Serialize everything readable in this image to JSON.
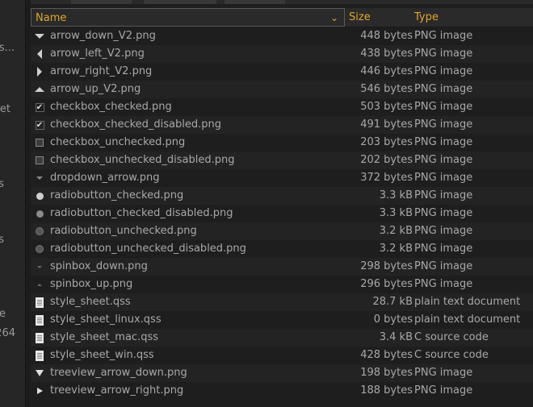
{
  "sidebar": {
    "fragments": [
      "s...",
      "et",
      "s",
      "s",
      "e",
      "264"
    ]
  },
  "header": {
    "name_label": "Name",
    "size_label": "Size",
    "type_label": "Type"
  },
  "files": [
    {
      "name": "arrow_down_V2.png",
      "size": "448 bytes",
      "type": "PNG image",
      "icon": "tri-down"
    },
    {
      "name": "arrow_left_V2.png",
      "size": "438 bytes",
      "type": "PNG image",
      "icon": "tri-left"
    },
    {
      "name": "arrow_right_V2.png",
      "size": "446 bytes",
      "type": "PNG image",
      "icon": "tri-right"
    },
    {
      "name": "arrow_up_V2.png",
      "size": "546 bytes",
      "type": "PNG image",
      "icon": "tri-up"
    },
    {
      "name": "checkbox_checked.png",
      "size": "503 bytes",
      "type": "PNG image",
      "icon": "check"
    },
    {
      "name": "checkbox_checked_disabled.png",
      "size": "491 bytes",
      "type": "PNG image",
      "icon": "check"
    },
    {
      "name": "checkbox_unchecked.png",
      "size": "203 bytes",
      "type": "PNG image",
      "icon": "square"
    },
    {
      "name": "checkbox_unchecked_disabled.png",
      "size": "202 bytes",
      "type": "PNG image",
      "icon": "square"
    },
    {
      "name": "dropdown_arrow.png",
      "size": "372 bytes",
      "type": "PNG image",
      "icon": "small-down"
    },
    {
      "name": "radiobutton_checked.png",
      "size": "3.3 kB",
      "type": "PNG image",
      "icon": "circle"
    },
    {
      "name": "radiobutton_checked_disabled.png",
      "size": "3.3 kB",
      "type": "PNG image",
      "icon": "circle-mid"
    },
    {
      "name": "radiobutton_unchecked.png",
      "size": "3.2 kB",
      "type": "PNG image",
      "icon": "circle-dark"
    },
    {
      "name": "radiobutton_unchecked_disabled.png",
      "size": "3.2 kB",
      "type": "PNG image",
      "icon": "circle-dark"
    },
    {
      "name": "spinbox_down.png",
      "size": "298 bytes",
      "type": "PNG image",
      "icon": "tiny-down"
    },
    {
      "name": "spinbox_up.png",
      "size": "296 bytes",
      "type": "PNG image",
      "icon": "tiny-up"
    },
    {
      "name": "style_sheet.qss",
      "size": "28.7 kB",
      "type": "plain text document",
      "icon": "doc"
    },
    {
      "name": "style_sheet_linux.qss",
      "size": "0 bytes",
      "type": "plain text document",
      "icon": "doc"
    },
    {
      "name": "style_sheet_mac.qss",
      "size": "3.4 kB",
      "type": "C source code",
      "icon": "doc"
    },
    {
      "name": "style_sheet_win.qss",
      "size": "428 bytes",
      "type": "C source code",
      "icon": "doc"
    },
    {
      "name": "treeview_arrow_down.png",
      "size": "198 bytes",
      "type": "PNG image",
      "icon": "tree-down"
    },
    {
      "name": "treeview_arrow_right.png",
      "size": "188 bytes",
      "type": "PNG image",
      "icon": "tree-right"
    }
  ]
}
